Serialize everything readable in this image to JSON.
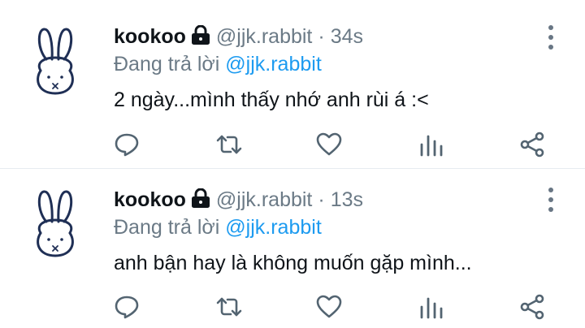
{
  "tweets": [
    {
      "name": "kookoo",
      "handle": "@jjk.rabbit",
      "separator": "·",
      "time": "34s",
      "reply_prefix": "Đang trả lời",
      "reply_to": "@jjk.rabbit",
      "text": "2 ngày...mình thấy nhớ anh rùi á :<"
    },
    {
      "name": "kookoo",
      "handle": "@jjk.rabbit",
      "separator": "·",
      "time": "13s",
      "reply_prefix": "Đang trả lời",
      "reply_to": "@jjk.rabbit",
      "text": "anh bận hay là không muốn gặp mình..."
    }
  ],
  "icons": {
    "reply": "reply-icon",
    "retweet": "retweet-icon",
    "like": "heart-icon",
    "stats": "stats-icon",
    "share": "share-icon",
    "more": "more-vertical-icon",
    "lock": "lock-icon"
  },
  "colors": {
    "text": "#0f1419",
    "secondary": "#6b7a86",
    "mention": "#1d9bf0",
    "divider": "#e6ecf0",
    "icon": "#536471"
  }
}
